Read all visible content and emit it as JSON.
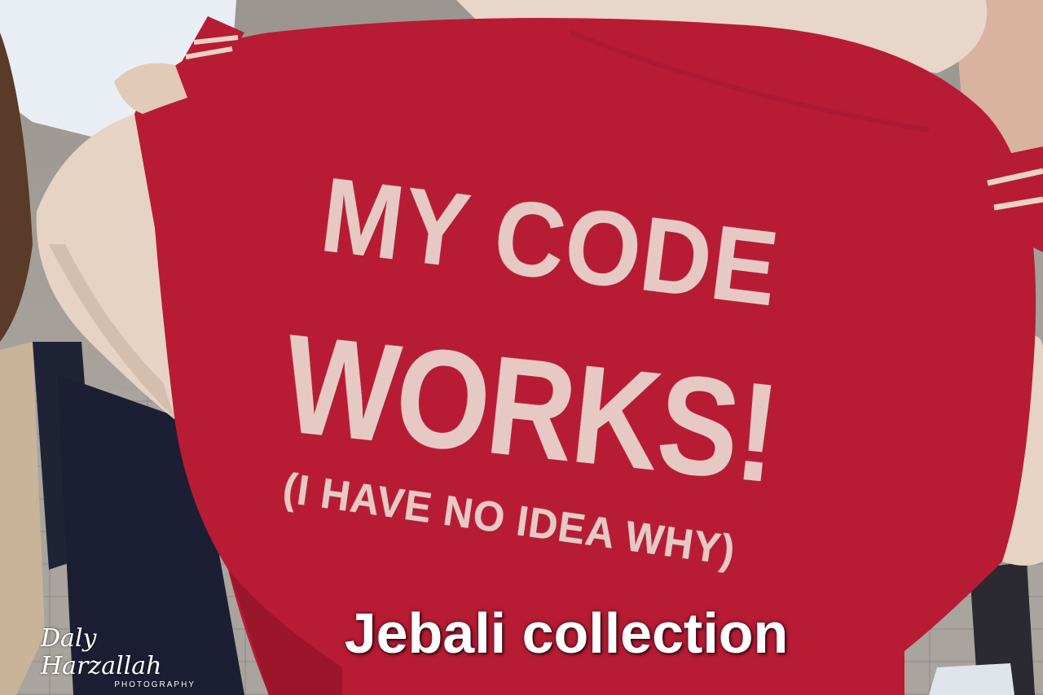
{
  "shirt_print": {
    "line1": "MY CODE",
    "line2": "WORKS!",
    "line3": "(I HAVE NO IDEA WHY)"
  },
  "caption": "Jebali collection",
  "watermark": {
    "name": "Daly Harzallah",
    "subtitle": "PHOTOGRAPHY"
  },
  "colors": {
    "jacket_red": "#b71c34",
    "sleeve_beige": "#e6d3c4",
    "print_text": "#e7c9c4",
    "caption_text": "#ffffff"
  }
}
